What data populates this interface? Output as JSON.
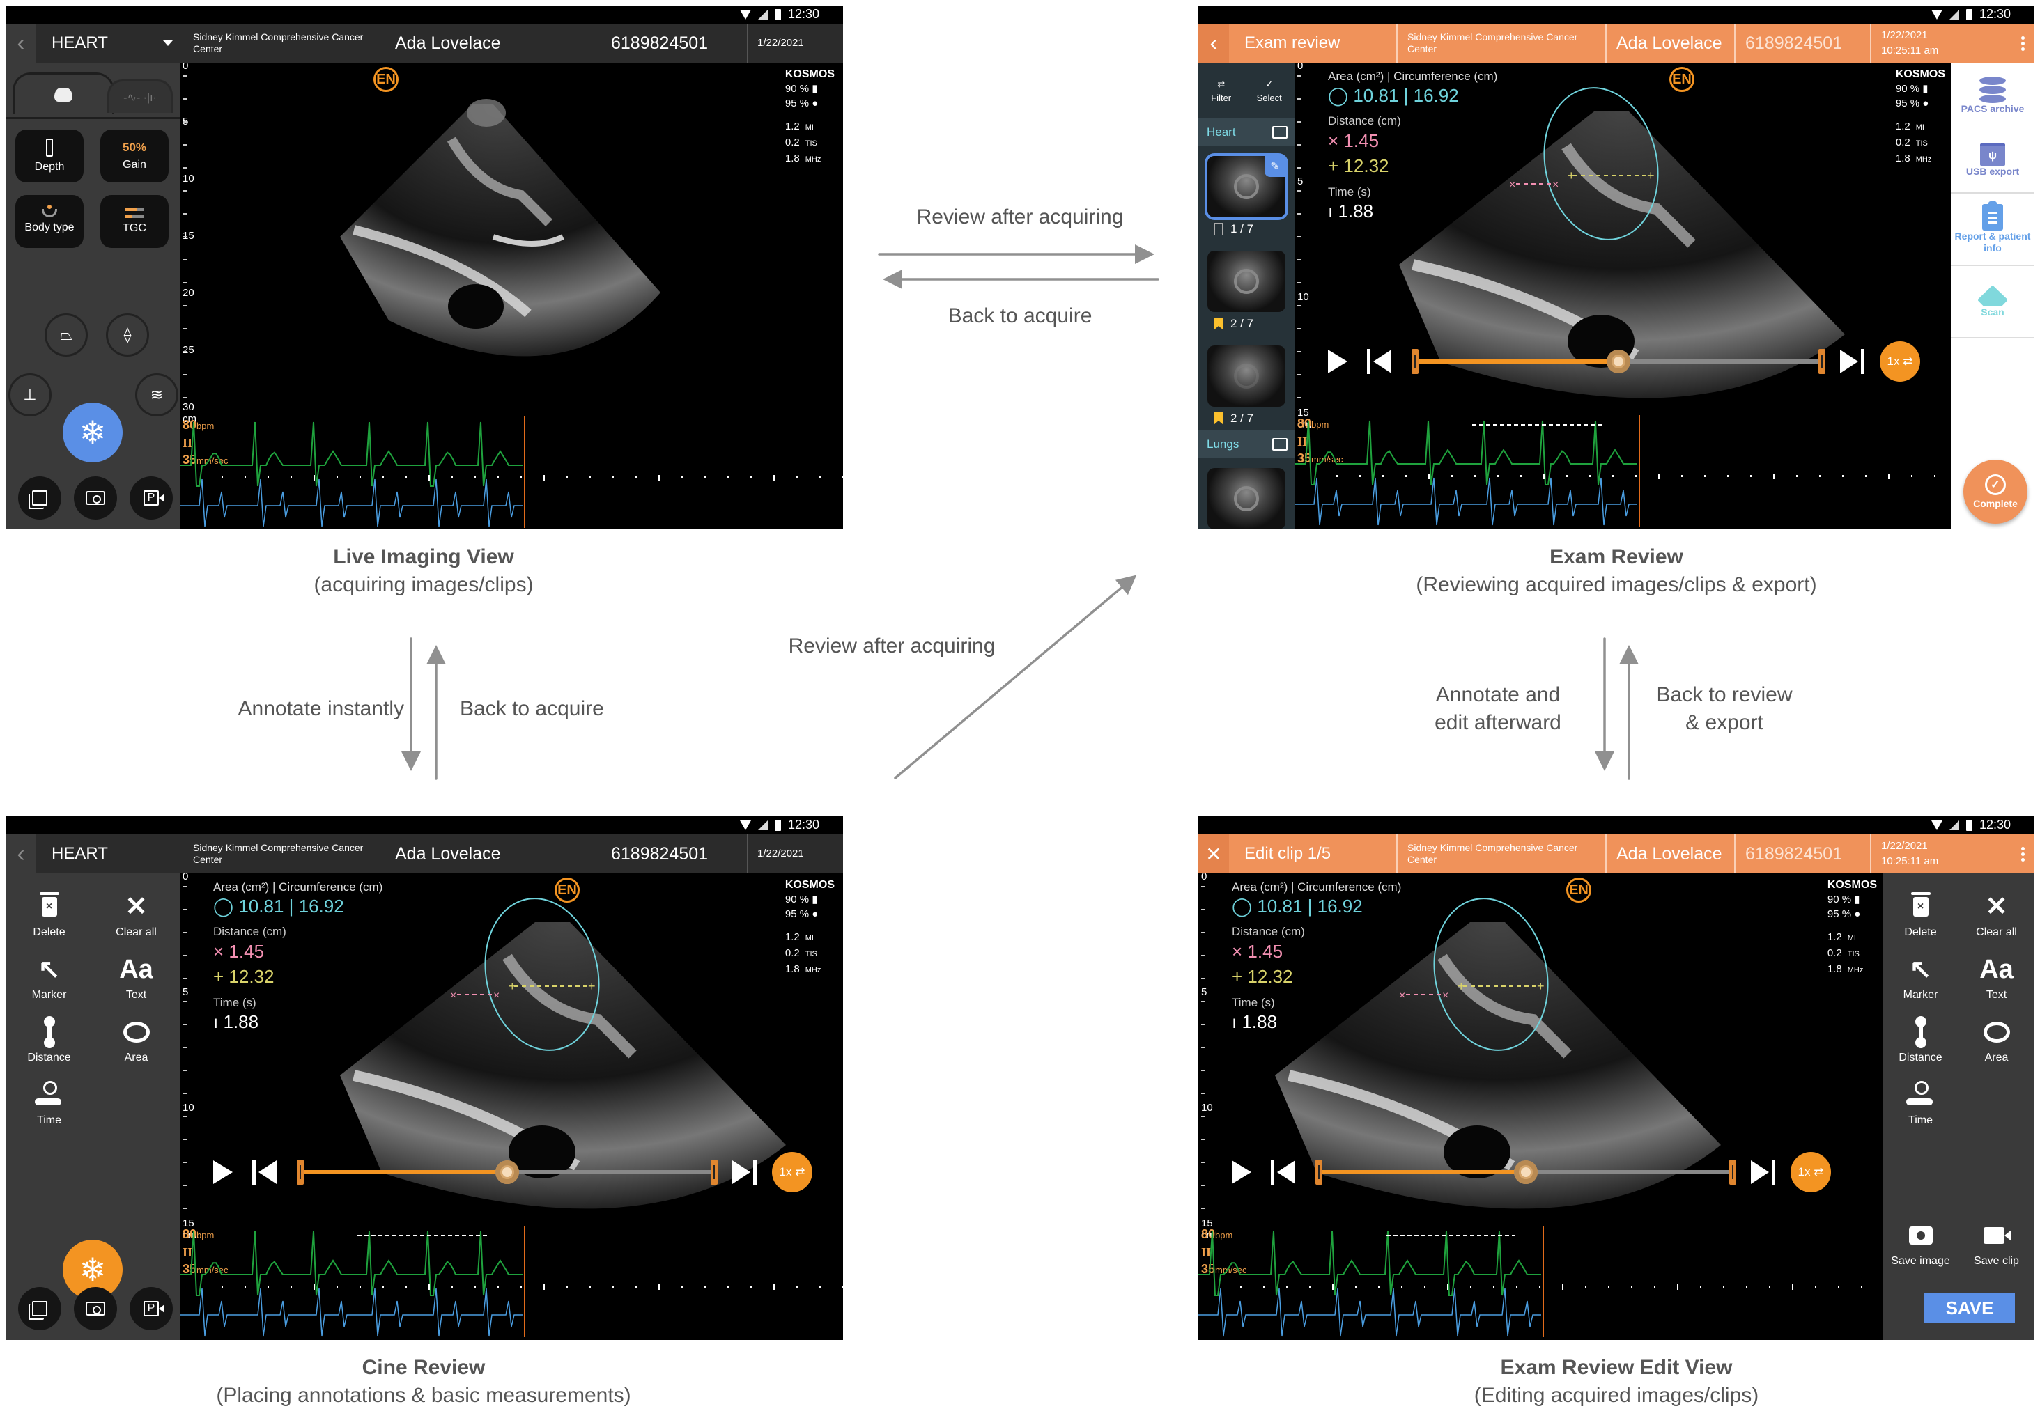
{
  "status_bar": {
    "time": "12:30"
  },
  "common": {
    "facility": "Sidney Kimmel Comprehensive Cancer Center",
    "patient_name": "Ada Lovelace",
    "patient_id": "6189824501",
    "date": "1/22/2021",
    "time": "10:25:11 am",
    "device": "KOSMOS",
    "battery": "90 %",
    "probe_battery": "95 %",
    "mi_value": "1.2",
    "mi_unit": "MI",
    "tis_value": "0.2",
    "tis_unit": "TIS",
    "freq_value": "1.8",
    "freq_unit": "MHz",
    "logo": "EN",
    "heart_rate": "80",
    "heart_rate_unit": "bpm",
    "lead": "II",
    "sweep_speed": "35",
    "sweep_speed_unit": "mm/sec",
    "area_label": "Area (cm²) | Circumference (cm)",
    "area_value": "10.81 | 16.92",
    "distance_label": "Distance (cm)",
    "distance_1": "1.45",
    "distance_2": "12.32",
    "time_label": "Time (s)",
    "time_value": "1.88",
    "speed_label": "1x",
    "playback_progress": 0.5
  },
  "colors": {
    "accent_orange": "#f0925a",
    "control_orange": "#f39422",
    "freeze_blue": "#5a8fe6",
    "area_cyan": "#6fd3dc",
    "distance_pink": "#f28fb1",
    "distance_yellow": "#d9d36a",
    "ecg_green": "#1fa23d",
    "doppler_blue": "#4a9de0"
  },
  "live": {
    "back_icon": "chevron-left",
    "title": "HEART",
    "tabs": [
      {
        "icon": "probe-sector-icon"
      },
      {
        "icon": "ecg-doppler-icon"
      }
    ],
    "controls": [
      {
        "label": "Depth",
        "icon": "depth-ruler-icon"
      },
      {
        "label": "Gain",
        "value": "50%"
      },
      {
        "label": "Body type",
        "icon": "body-type-icon"
      },
      {
        "label": "TGC",
        "icon": "tgc-sliders-icon"
      }
    ],
    "depth_ticks": [
      "0",
      "5",
      "10",
      "15",
      "20",
      "25",
      "30 cm"
    ],
    "mode_buttons": [
      "sector-adjust-icon",
      "focus-icon",
      "caliper-icon",
      "wave-icon"
    ],
    "freeze_icon": "snowflake",
    "bottom_buttons": [
      "gallery-icon",
      "camera-icon",
      "record-clip-icon"
    ],
    "caption_title": "Live Imaging View",
    "caption_sub": "(acquiring images/clips)"
  },
  "exam": {
    "title": "Exam review",
    "actions": [
      {
        "label": "Filter",
        "icon": "⇄"
      },
      {
        "label": "Select",
        "icon": "✓"
      }
    ],
    "groups": [
      {
        "name": "Heart",
        "items": [
          {
            "count": "1 / 7",
            "bookmarked": false,
            "selected": true
          },
          {
            "count": "2 / 7",
            "bookmarked": true,
            "selected": false
          },
          {
            "count": "2 / 7",
            "bookmarked": true,
            "selected": false
          }
        ]
      },
      {
        "name": "Lungs",
        "items": [
          {
            "count": "",
            "bookmarked": false,
            "selected": false
          }
        ]
      }
    ],
    "depth_ticks": [
      "0",
      "5",
      "10",
      "15 cm"
    ],
    "side_actions": [
      {
        "label": "PACS archive"
      },
      {
        "label": "USB export"
      },
      {
        "label": "Report & patient info"
      },
      {
        "label": "Scan"
      }
    ],
    "complete_label": "Complete",
    "caption_title": "Exam Review",
    "caption_sub": "(Reviewing acquired images/clips & export)"
  },
  "cine": {
    "title": "HEART",
    "tools": [
      {
        "label": "Delete"
      },
      {
        "label": "Clear all"
      },
      {
        "label": "Marker"
      },
      {
        "label": "Text",
        "glyph": "Aa"
      },
      {
        "label": "Distance"
      },
      {
        "label": "Area"
      },
      {
        "label": "Time"
      }
    ],
    "depth_ticks": [
      "0",
      "5",
      "10",
      "15 cm"
    ],
    "caption_title": "Cine Review",
    "caption_sub": "(Placing annotations & basic measurements)"
  },
  "edit": {
    "title": "Edit clip 1/5",
    "tools": [
      {
        "label": "Delete"
      },
      {
        "label": "Clear all"
      },
      {
        "label": "Marker"
      },
      {
        "label": "Text",
        "glyph": "Aa"
      },
      {
        "label": "Distance"
      },
      {
        "label": "Area"
      },
      {
        "label": "Time"
      }
    ],
    "save_image": "Save image",
    "save_clip": "Save clip",
    "save_button": "SAVE",
    "depth_ticks": [
      "0",
      "5",
      "10",
      "15 cm"
    ],
    "caption_title": "Exam Review Edit View",
    "caption_sub": "(Editing acquired images/clips)"
  },
  "flows": {
    "live_to_exam": "Review after acquiring",
    "exam_to_live": "Back to acquire",
    "live_to_cine": "Annotate instantly",
    "cine_to_live": "Back to acquire",
    "cine_to_exam": "Review after acquiring",
    "exam_to_edit_1": "Annotate and",
    "exam_to_edit_2": "edit afterward",
    "edit_to_exam_1": "Back to review",
    "edit_to_exam_2": "& export"
  }
}
